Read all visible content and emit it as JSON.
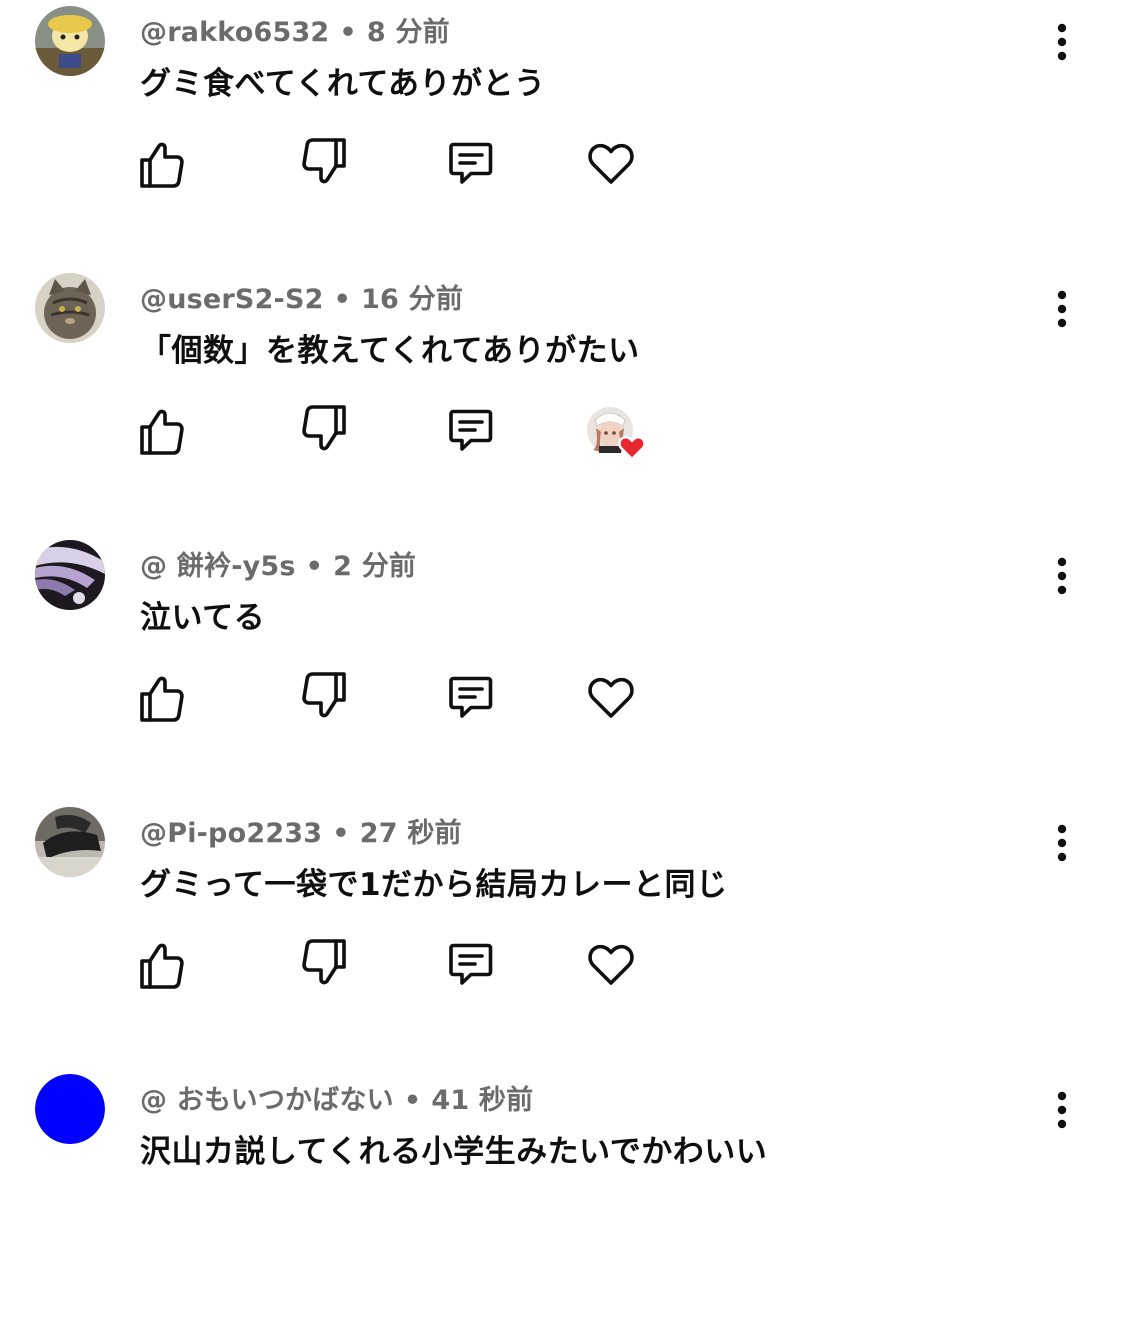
{
  "comments": [
    {
      "username": "@rakko6532",
      "time": "8 分前",
      "text": "グミ食べてくれてありがとう",
      "avatar": "character-avatar",
      "hearted": false
    },
    {
      "username": "@userS2-S2",
      "time": "16 分前",
      "text": "「個数」を教えてくれてありがたい",
      "avatar": "cat-avatar",
      "hearted": true
    },
    {
      "username": "@ 餅衿-y5s",
      "time": "2 分前",
      "text": "泣いてる",
      "avatar": "anime-avatar",
      "hearted": false
    },
    {
      "username": "@Pi-po2233",
      "time": "27 秒前",
      "text": "グミって一袋で1だから結局カレーと同じ",
      "avatar": "photo-avatar",
      "hearted": false
    },
    {
      "username": "@ おもいつかばない",
      "time": "41 秒前",
      "text": "沢山カ説してくれる小学生みたいでかわいい",
      "avatar": "blue-circle-avatar",
      "hearted": false
    }
  ],
  "separator": "•",
  "colors": {
    "meta": "#6b6b6b",
    "text": "#0f0f0f",
    "heart_badge": "#e8262f",
    "blue_avatar": "#0000ff"
  }
}
